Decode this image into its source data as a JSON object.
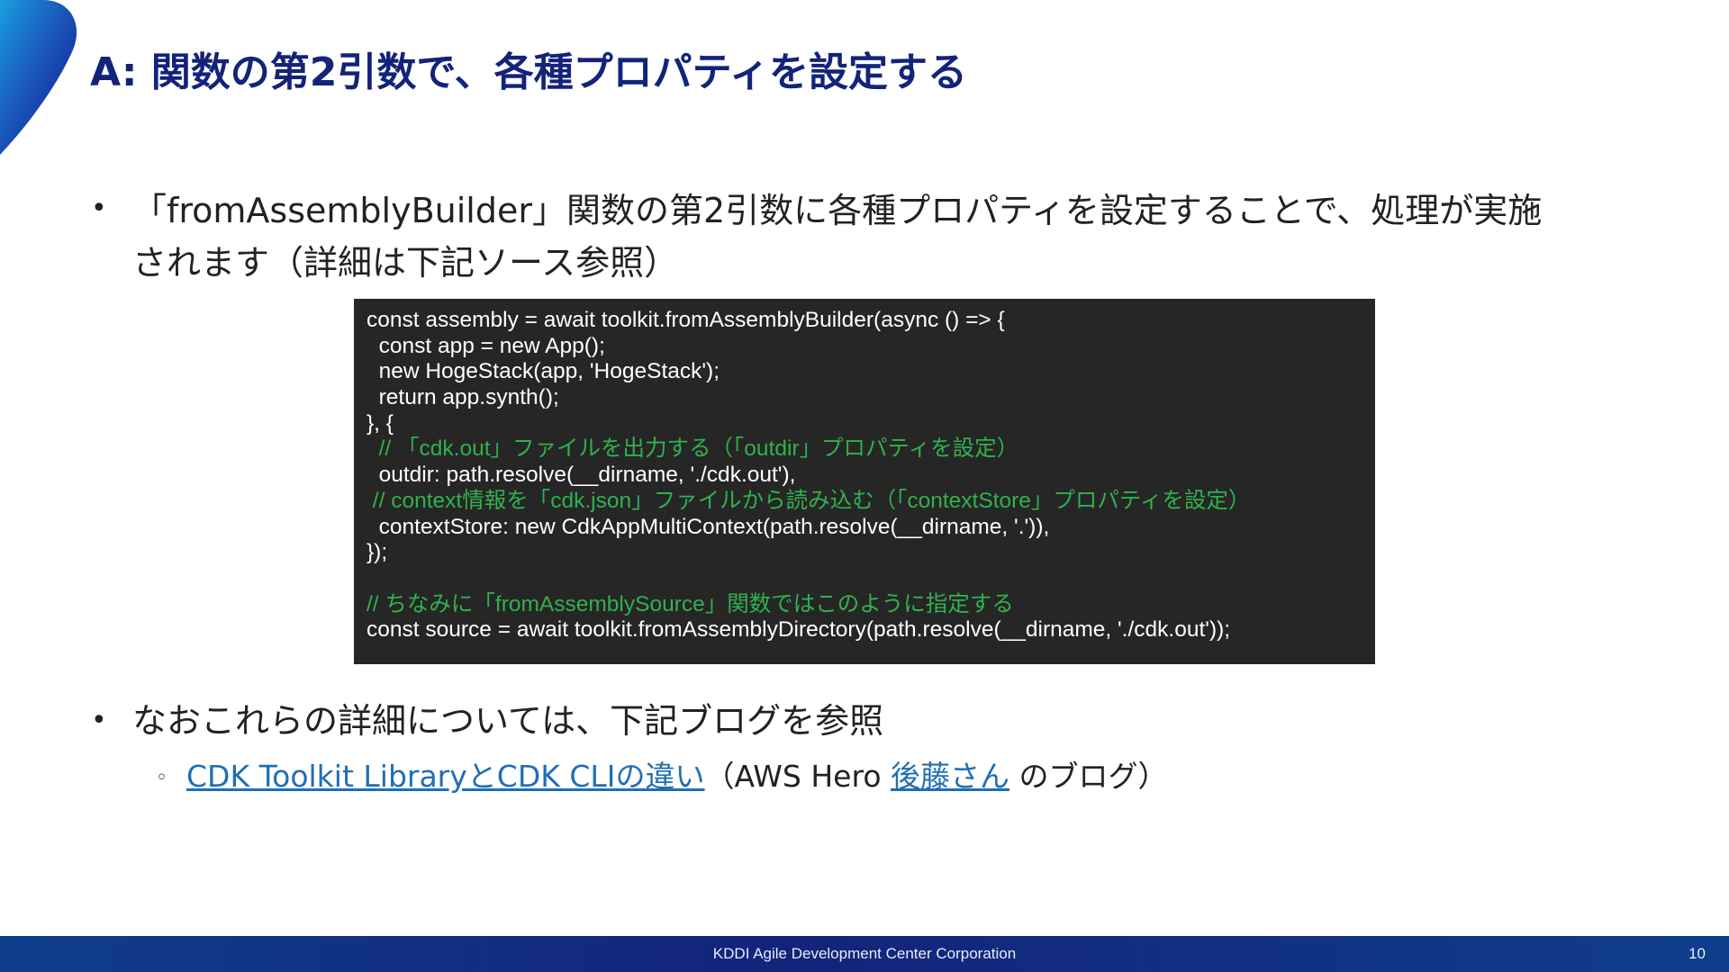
{
  "title": "A: 関数の第2引数で、各種プロパティを設定する",
  "bullets": {
    "first_line1": "「fromAssemblyBuilder」関数の第2引数に各種プロパティを設定することで、処理が実施",
    "first_line2": "されます（詳細は下記ソース参照）",
    "second": "なおこれらの詳細については、下記ブログを参照"
  },
  "code_lines": [
    {
      "text": "const assembly = await toolkit.fromAssemblyBuilder(async () => {",
      "comment": false
    },
    {
      "text": "  const app = new App();",
      "comment": false
    },
    {
      "text": "  new HogeStack(app, 'HogeStack');",
      "comment": false
    },
    {
      "text": "  return app.synth();",
      "comment": false
    },
    {
      "text": "}, {",
      "comment": false
    },
    {
      "text": "  // 「cdk.out」ファイルを出力する（「outdir」プロパティを設定）",
      "comment": true
    },
    {
      "text": "  outdir: path.resolve(__dirname, './cdk.out'),",
      "comment": false
    },
    {
      "text": " // context情報を「cdk.json」ファイルから読み込む（「contextStore」プロパティを設定）",
      "comment": true
    },
    {
      "text": "  contextStore: new CdkAppMultiContext(path.resolve(__dirname, '.')),",
      "comment": false
    },
    {
      "text": "});",
      "comment": false
    },
    {
      "text": "",
      "comment": false
    },
    {
      "text": "// ちなみに「fromAssemblySource」関数ではこのように指定する",
      "comment": true
    },
    {
      "text": "const source = await toolkit.fromAssemblyDirectory(path.resolve(__dirname, './cdk.out'));",
      "comment": false
    }
  ],
  "sub_bullet": {
    "marker": "◦",
    "link1": "CDK Toolkit LibraryとCDK CLIの違い",
    "middle": "（AWS Hero ",
    "link2": "後藤さん",
    "suffix": " のブログ）"
  },
  "footer": {
    "company": "KDDI Agile Development Center Corporation",
    "page_number": "10"
  },
  "colors": {
    "title": "#13237a",
    "link": "#1f6fb2",
    "code_background": "#262626",
    "code_comment": "#2fb24d",
    "footer": "#13237a"
  }
}
